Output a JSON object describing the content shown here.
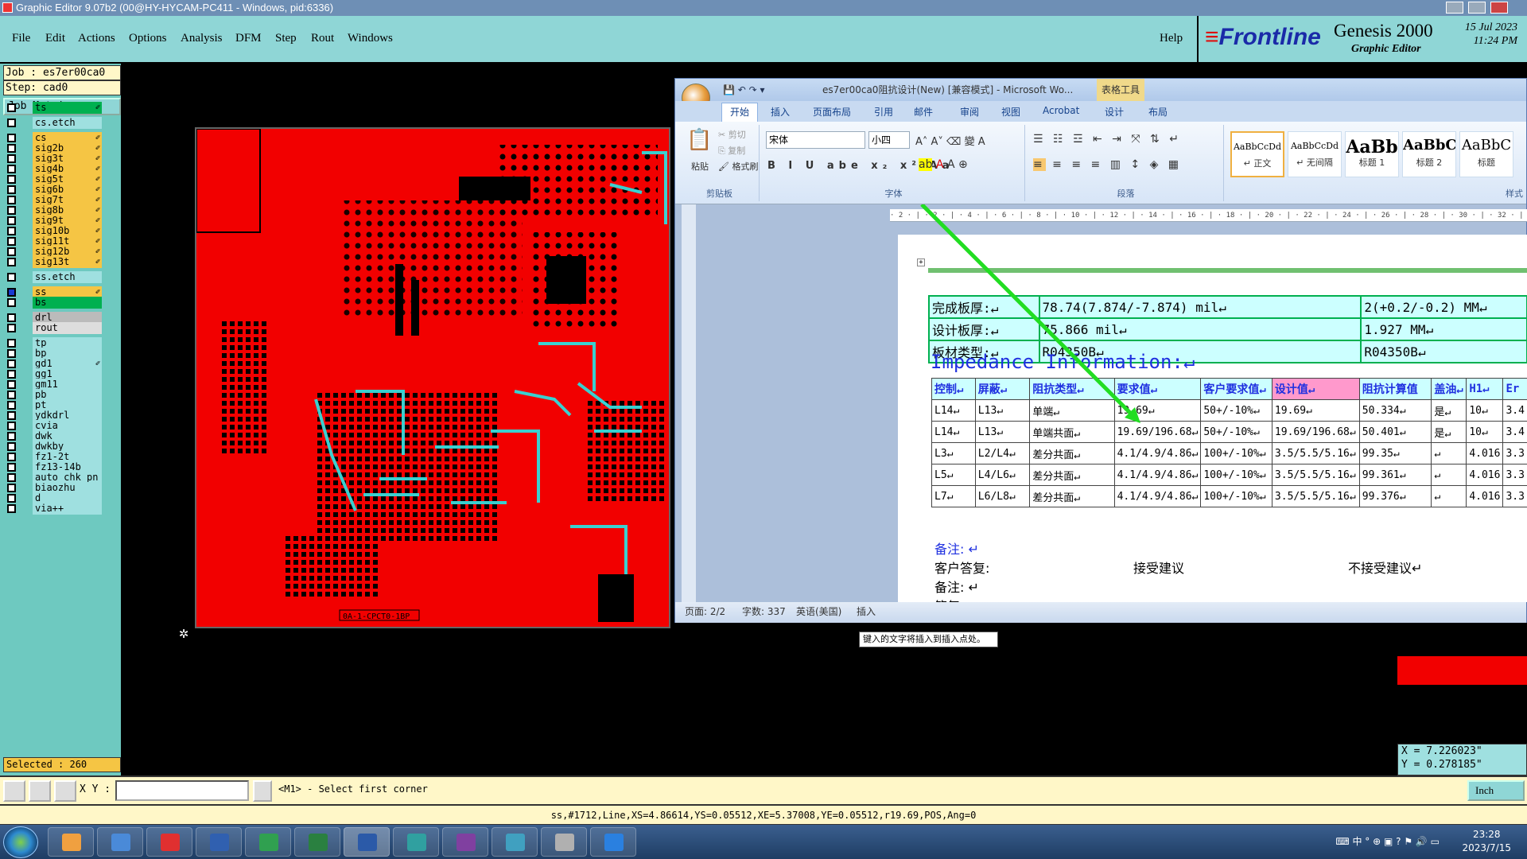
{
  "window_title": "Graphic Editor 9.07b2 (00@HY-HYCAM-PC411 - Windows, pid:6336)",
  "menu": [
    "File",
    "Edit",
    "Actions",
    "Options",
    "Analysis",
    "DFM",
    "Step",
    "Rout",
    "Windows"
  ],
  "help": "Help",
  "brand": {
    "logo": "Frontline",
    "product": "Genesis 2000",
    "sub": "Graphic Editor",
    "date": "15 Jul 2023",
    "time": "11:24 PM"
  },
  "job": {
    "job": "Job : es7er00ca0",
    "step": "Step: cad0",
    "matrix": "Job Matrix ..."
  },
  "layers": [
    {
      "name": "ts",
      "bg": "#00b050",
      "edit": "✐"
    },
    {
      "name": "cs.etch",
      "bg": "#9fe0e0",
      "edit": ""
    },
    {
      "name": "cs",
      "bg": "#f5c544",
      "edit": "✐"
    },
    {
      "name": "sig2b",
      "bg": "#f5c544",
      "edit": "✐"
    },
    {
      "name": "sig3t",
      "bg": "#f5c544",
      "edit": "✐"
    },
    {
      "name": "sig4b",
      "bg": "#f5c544",
      "edit": "✐"
    },
    {
      "name": "sig5t",
      "bg": "#f5c544",
      "edit": "✐"
    },
    {
      "name": "sig6b",
      "bg": "#f5c544",
      "edit": "✐"
    },
    {
      "name": "sig7t",
      "bg": "#f5c544",
      "edit": "✐"
    },
    {
      "name": "sig8b",
      "bg": "#f5c544",
      "edit": "✐"
    },
    {
      "name": "sig9t",
      "bg": "#f5c544",
      "edit": "✐"
    },
    {
      "name": "sig10b",
      "bg": "#f5c544",
      "edit": "✐"
    },
    {
      "name": "sig11t",
      "bg": "#f5c544",
      "edit": "✐"
    },
    {
      "name": "sig12b",
      "bg": "#f5c544",
      "edit": "✐"
    },
    {
      "name": "sig13t",
      "bg": "#f5c544",
      "edit": "✐"
    },
    {
      "name": "ss.etch",
      "bg": "#9fe0e0",
      "edit": ""
    },
    {
      "name": "ss",
      "bg": "#f5c544",
      "edit": "✐"
    },
    {
      "name": "bs",
      "bg": "#00b050",
      "edit": ""
    },
    {
      "name": "drl",
      "bg": "#bbbbbb",
      "edit": ""
    },
    {
      "name": "rout",
      "bg": "#dddddd",
      "edit": ""
    },
    {
      "name": "tp",
      "bg": "#9fe0e0",
      "edit": ""
    },
    {
      "name": "bp",
      "bg": "#9fe0e0",
      "edit": ""
    },
    {
      "name": "gd1",
      "bg": "#9fe0e0",
      "edit": "✐"
    },
    {
      "name": "gg1",
      "bg": "#9fe0e0",
      "edit": ""
    },
    {
      "name": "gm11",
      "bg": "#9fe0e0",
      "edit": ""
    },
    {
      "name": "pb",
      "bg": "#9fe0e0",
      "edit": ""
    },
    {
      "name": "pt",
      "bg": "#9fe0e0",
      "edit": ""
    },
    {
      "name": "ydkdrl",
      "bg": "#9fe0e0",
      "edit": ""
    },
    {
      "name": "cvia",
      "bg": "#9fe0e0",
      "edit": ""
    },
    {
      "name": "dwk",
      "bg": "#9fe0e0",
      "edit": ""
    },
    {
      "name": "dwkby",
      "bg": "#9fe0e0",
      "edit": ""
    },
    {
      "name": "fz1-2t",
      "bg": "#9fe0e0",
      "edit": ""
    },
    {
      "name": "fz13-14b",
      "bg": "#9fe0e0",
      "edit": ""
    },
    {
      "name": "auto_chk_pn",
      "bg": "#9fe0e0",
      "edit": ""
    },
    {
      "name": "biaozhu",
      "bg": "#9fe0e0",
      "edit": ""
    },
    {
      "name": "d",
      "bg": "#9fe0e0",
      "edit": ""
    },
    {
      "name": "via++",
      "bg": "#9fe0e0",
      "edit": ""
    }
  ],
  "selected": "Selected : 260",
  "pcb_label": "0A-1-CPCT0-1BP",
  "word": {
    "title": "es7er00ca0阻抗设计(New) [兼容模式] - Microsoft Wo...",
    "table_tools": "表格工具",
    "tabs": [
      "开始",
      "插入",
      "页面布局",
      "引用",
      "邮件",
      "审阅",
      "视图",
      "Acrobat",
      "设计",
      "布局"
    ],
    "clipboard": {
      "paste": "粘贴",
      "cut": "剪切",
      "copy": "复制",
      "format": "格式刷",
      "label": "剪贴板"
    },
    "font_name": "宋体",
    "font_size": "小四",
    "font_label": "字体",
    "para_label": "段落",
    "styles": [
      {
        "preview": "AaBbCcDd",
        "name": "↵ 正文"
      },
      {
        "preview": "AaBbCcDd",
        "name": "↵ 无间隔"
      },
      {
        "preview": "AaBb",
        "name": "标题 1"
      },
      {
        "preview": "AaBbC",
        "name": "标题 2"
      },
      {
        "preview": "AaBbC",
        "name": "标题"
      }
    ],
    "styles_label": "样式",
    "ruler": "· 2 · | · 2 · | · 4 · | · 6 · | · 8 · | · 10 · | · 12 · | · 14 · | · 16 · | · 18 · | · 20 · | · 22 · | · 24 · | · 26 · | · 28 · | · 30 · | · 32 · | · 34 · | · 36 · | · 38 · | · 40 · | · 42 ·",
    "info_rows": [
      [
        "完成板厚:↵",
        "78.74(7.874/-7.874) mil↵",
        "2(+0.2/-0.2) MM↵"
      ],
      [
        "设计板厚:↵",
        "75.866 mil↵",
        "1.927 MM↵"
      ],
      [
        "板材类型:↵",
        "R04350B↵",
        "R04350B↵"
      ]
    ],
    "impedance_title": "Impedance Information:↵",
    "imp_header": [
      "控制↵",
      "屏蔽↵",
      "阻抗类型↵",
      "要求值↵",
      "客户要求值↵",
      "设计值↵",
      "阻抗计算值",
      "盖油↵",
      "H1↵",
      "Er"
    ],
    "imp_rows": [
      [
        "L14↵",
        "L13↵",
        "单端↵",
        "19.69↵",
        "50+/-10%↵",
        "19.69↵",
        "50.334↵",
        "是↵",
        "10↵",
        "3.4"
      ],
      [
        "L14↵",
        "L13↵",
        "单端共面↵",
        "19.69/196.68↵",
        "50+/-10%↵",
        "19.69/196.68↵",
        "50.401↵",
        "是↵",
        "10↵",
        "3.4"
      ],
      [
        "L3↵",
        "L2/L4↵",
        "差分共面↵",
        "4.1/4.9/4.86↵",
        "100+/-10%↵",
        "3.5/5.5/5.16↵",
        "99.35↵",
        "↵",
        "4.016",
        "3.3"
      ],
      [
        "L5↵",
        "L4/L6↵",
        "差分共面↵",
        "4.1/4.9/4.86↵",
        "100+/-10%↵",
        "3.5/5.5/5.16↵",
        "99.361↵",
        "↵",
        "4.016",
        "3.3"
      ],
      [
        "L7↵",
        "L6/L8↵",
        "差分共面↵",
        "4.1/4.9/4.86↵",
        "100+/-10%↵",
        "3.5/5.5/5.16↵",
        "99.376↵",
        "↵",
        "4.016",
        "3.3"
      ]
    ],
    "note1": "备注: ↵",
    "reply_label": "客户答复:",
    "accept": "接受建议",
    "reject": "不接受建议↵",
    "note2": "备注: ↵",
    "reply2": "答复: ↵",
    "status": {
      "page": "页面: 2/2",
      "words": "字数: 337",
      "lang": "英语(美国)",
      "mode": "插入"
    }
  },
  "tooltip": "键入的文字将插入到插入点处。",
  "coords": {
    "x": "X = 7.226023\"",
    "y": "Y = 0.278185\""
  },
  "cmd": {
    "xy_label": "X Y :",
    "prompt": "<M1> - Select first corner",
    "units": "Inch"
  },
  "infobar": "ss,#1712,Line,XS=4.86614,YS=0.05512,XE=5.37008,YE=0.05512,r19.69,POS,Ang=0",
  "clock": {
    "time": "23:28",
    "date": "2023/7/15"
  },
  "tray": "⌨ 中 ° ⊕ ▣ ? ⚑ 🔊 ▭"
}
